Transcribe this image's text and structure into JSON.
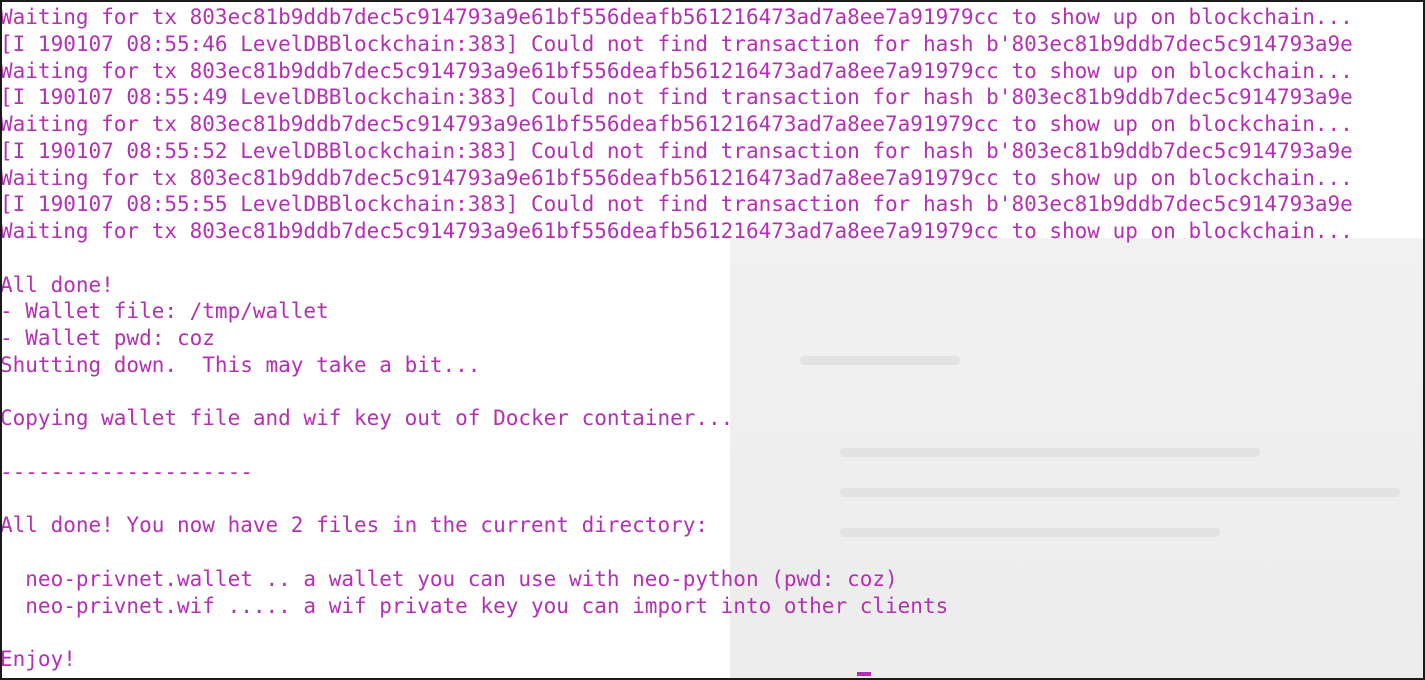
{
  "terminal": {
    "lines": [
      "Waiting for tx 803ec81b9ddb7dec5c914793a9e61bf556deafb561216473ad7a8ee7a91979cc to show up on blockchain...",
      "[I 190107 08:55:46 LevelDBBlockchain:383] Could not find transaction for hash b'803ec81b9ddb7dec5c914793a9e",
      "Waiting for tx 803ec81b9ddb7dec5c914793a9e61bf556deafb561216473ad7a8ee7a91979cc to show up on blockchain...",
      "[I 190107 08:55:49 LevelDBBlockchain:383] Could not find transaction for hash b'803ec81b9ddb7dec5c914793a9e",
      "Waiting for tx 803ec81b9ddb7dec5c914793a9e61bf556deafb561216473ad7a8ee7a91979cc to show up on blockchain...",
      "[I 190107 08:55:52 LevelDBBlockchain:383] Could not find transaction for hash b'803ec81b9ddb7dec5c914793a9e",
      "Waiting for tx 803ec81b9ddb7dec5c914793a9e61bf556deafb561216473ad7a8ee7a91979cc to show up on blockchain...",
      "[I 190107 08:55:55 LevelDBBlockchain:383] Could not find transaction for hash b'803ec81b9ddb7dec5c914793a9e",
      "Waiting for tx 803ec81b9ddb7dec5c914793a9e61bf556deafb561216473ad7a8ee7a91979cc to show up on blockchain...",
      "",
      "All done!",
      "- Wallet file: /tmp/wallet",
      "- Wallet pwd: coz",
      "Shutting down.  This may take a bit...",
      "",
      "Copying wallet file and wif key out of Docker container...",
      "",
      "--------------------",
      "",
      "All done! You now have 2 files in the current directory:",
      "",
      "  neo-privnet.wallet .. a wallet you can use with neo-python (pwd: coz)",
      "  neo-privnet.wif ..... a wif private key you can import into other clients",
      "",
      "Enjoy!"
    ]
  },
  "colors": {
    "text": "#b52fb5",
    "background": "#ffffff"
  }
}
